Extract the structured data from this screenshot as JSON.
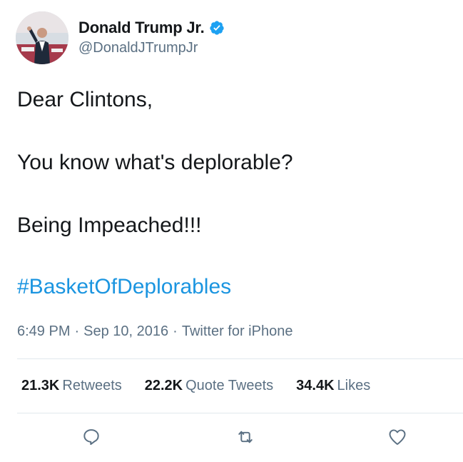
{
  "author": {
    "display_name": "Donald Trump Jr.",
    "handle": "@DonaldJTrumpJr",
    "verified": true,
    "verified_color": "#1da1f2",
    "avatar_icon": "profile-photo"
  },
  "tweet": {
    "line1": "Dear Clintons,",
    "line2": "You know what's deplorable?",
    "line3": "Being Impeached!!!",
    "hashtag": "#BasketOfDeplorables",
    "hashtag_color": "#1b95e0"
  },
  "meta": {
    "time": "6:49 PM",
    "sep1": "·",
    "date": "Sep 10, 2016",
    "sep2": "·",
    "source": "Twitter for iPhone"
  },
  "stats": [
    {
      "count": "21.3K",
      "label": "Retweets"
    },
    {
      "count": "22.2K",
      "label": "Quote Tweets"
    },
    {
      "count": "34.4K",
      "label": "Likes"
    }
  ],
  "actions": {
    "reply_icon": "reply-icon",
    "retweet_icon": "retweet-icon",
    "like_icon": "heart-icon"
  }
}
